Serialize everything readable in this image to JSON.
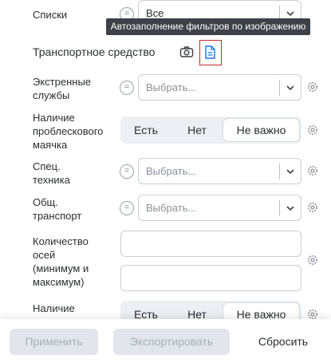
{
  "lists": {
    "label": "Списки",
    "value": "Все"
  },
  "tooltip": "Автозаполнение фильтров по изображению",
  "section": {
    "title": "Транспортное средство",
    "camera_icon": "camera-icon",
    "doc_icon": "document-icon"
  },
  "emergency": {
    "label_line1": "Экстренные",
    "label_line2": "службы",
    "placeholder": "Выбрать..."
  },
  "beacon": {
    "label_line1": "Наличие",
    "label_line2": "проблескового",
    "label_line3": "маячка",
    "options": [
      "Есть",
      "Нет",
      "Не важно"
    ],
    "selected": "Не важно"
  },
  "special": {
    "label_line1": "Спец.",
    "label_line2": "техника",
    "placeholder": "Выбрать..."
  },
  "public": {
    "label_line1": "Общ.",
    "label_line2": "транспорт",
    "placeholder": "Выбрать..."
  },
  "axles": {
    "label_line1": "Количество",
    "label_line2": "осей",
    "label_line3": "(минимум и",
    "label_line4": "максимум)"
  },
  "presence": {
    "label_line1": "Наличие",
    "options": [
      "Есть",
      "Нет",
      "Не важно"
    ],
    "selected": "Не важно"
  },
  "footer": {
    "apply": "Применить",
    "export": "Экспортировать",
    "reset": "Сбросить"
  },
  "colors": {
    "accent": "#1a73e8",
    "highlight_border": "#c62828",
    "disabled_bg": "#e2e6ec"
  }
}
